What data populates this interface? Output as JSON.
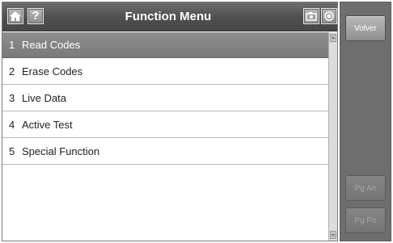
{
  "header": {
    "title": "Function Menu",
    "help_glyph": "?"
  },
  "menu": {
    "items": [
      {
        "num": "1",
        "label": "Read Codes",
        "selected": true
      },
      {
        "num": "2",
        "label": "Erase Codes",
        "selected": false
      },
      {
        "num": "3",
        "label": "Live Data",
        "selected": false
      },
      {
        "num": "4",
        "label": "Active Test",
        "selected": false
      },
      {
        "num": "5",
        "label": "Special Function",
        "selected": false
      }
    ]
  },
  "sidebar": {
    "back_label": "Volver",
    "page_up_label": "Pg An",
    "page_down_label": "Pg Po"
  },
  "icons": {
    "home": "home-icon",
    "help": "help-icon",
    "camera": "camera-icon",
    "record": "record-icon"
  },
  "colors": {
    "titlebar": "#555555",
    "selected_row": "#858585",
    "sidebar": "#6e6e6e"
  }
}
